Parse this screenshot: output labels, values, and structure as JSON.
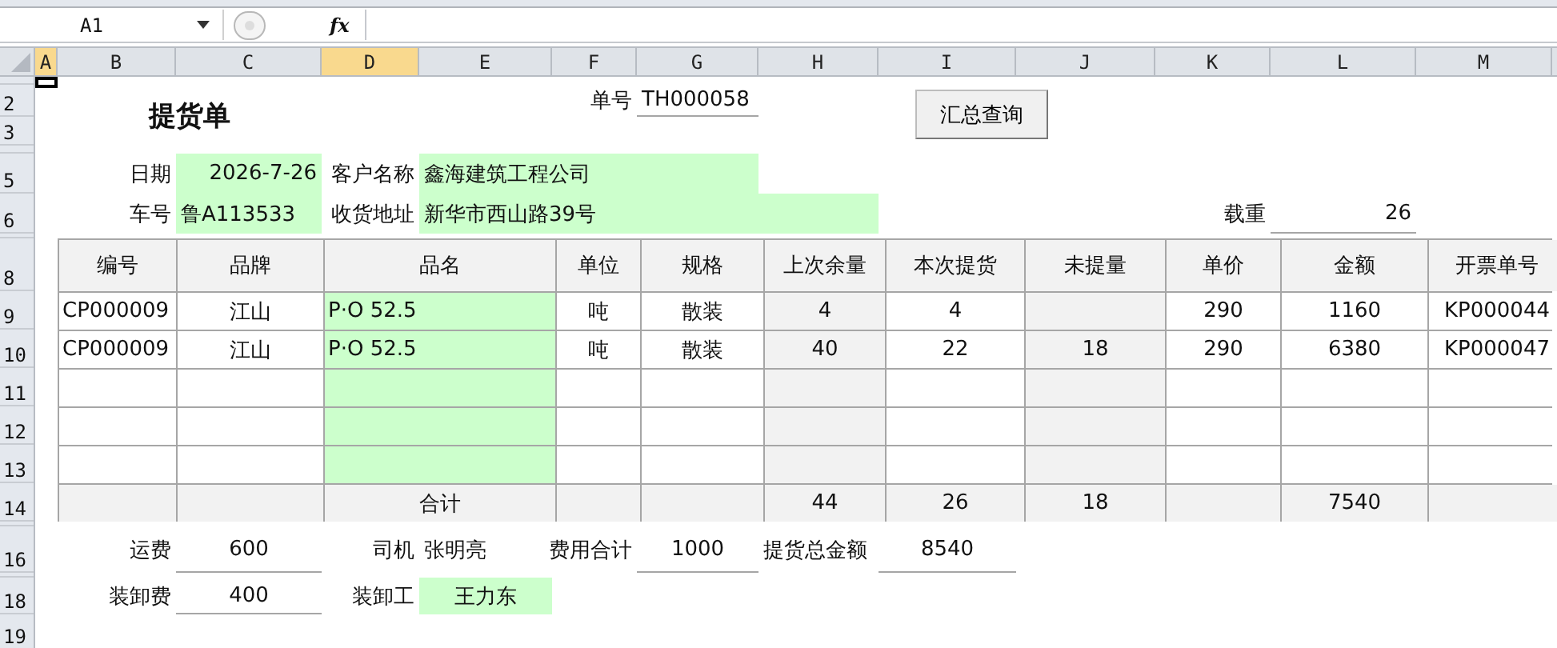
{
  "name_box": "A1",
  "function_label": "fx",
  "column_headers": [
    {
      "label": "A",
      "selected": true
    },
    {
      "label": "B",
      "selected": false
    },
    {
      "label": "C",
      "selected": false
    },
    {
      "label": "D",
      "selected": true
    },
    {
      "label": "E",
      "selected": false
    },
    {
      "label": "F",
      "selected": false
    },
    {
      "label": "G",
      "selected": false
    },
    {
      "label": "H",
      "selected": false
    },
    {
      "label": "I",
      "selected": false
    },
    {
      "label": "J",
      "selected": false
    },
    {
      "label": "K",
      "selected": false
    },
    {
      "label": "L",
      "selected": false
    },
    {
      "label": "M",
      "selected": false
    }
  ],
  "row_headers": [
    "2",
    "3",
    "5",
    "6",
    "8",
    "9",
    "10",
    "11",
    "12",
    "13",
    "14",
    "16",
    "18",
    "19"
  ],
  "form": {
    "title": "提货单",
    "order_no_label": "单号",
    "order_no": "TH000058",
    "summary_button": "汇总查询",
    "date_label": "日期",
    "date": "2026-7-26",
    "customer_label": "客户名称",
    "customer": "鑫海建筑工程公司",
    "plate_label": "车号",
    "plate": "鲁A113533",
    "address_label": "收货地址",
    "address": "新华市西山路39号",
    "load_label": "载重",
    "load": "26"
  },
  "table": {
    "columns": [
      "编号",
      "品牌",
      "品名",
      "单位",
      "规格",
      "上次余量",
      "本次提货",
      "未提量",
      "单价",
      "金额",
      "开票单号"
    ],
    "rows": [
      {
        "kind": "item",
        "cells": [
          "CP000009",
          "江山",
          "P·O 52.5",
          "吨",
          "散装",
          "4",
          "4",
          null,
          "290",
          "1160",
          "KP000044"
        ]
      },
      {
        "kind": "item",
        "cells": [
          "CP000009",
          "江山",
          "P·O 52.5",
          "吨",
          "散装",
          "40",
          "22",
          "18",
          "290",
          "6380",
          "KP000047"
        ]
      },
      {
        "kind": "item",
        "cells": [
          null,
          null,
          null,
          null,
          null,
          null,
          null,
          null,
          null,
          null,
          null
        ]
      },
      {
        "kind": "item",
        "cells": [
          null,
          null,
          null,
          null,
          null,
          null,
          null,
          null,
          null,
          null,
          null
        ]
      },
      {
        "kind": "item",
        "cells": [
          null,
          null,
          null,
          null,
          null,
          null,
          null,
          null,
          null,
          null,
          null
        ]
      },
      {
        "kind": "total",
        "cells": [
          null,
          null,
          "合计",
          null,
          null,
          "44",
          "26",
          "18",
          null,
          "7540",
          null
        ]
      }
    ]
  },
  "footer": {
    "freight_label": "运费",
    "freight": "600",
    "driver_label": "司机",
    "driver": "张明亮",
    "fee_total_label": "费用合计",
    "fee_total": "1000",
    "grand_total_label": "提货总金额",
    "grand_total": "8540",
    "loading_fee_label": "装卸费",
    "loading_fee": "400",
    "loader_label": "装卸工",
    "loader": "王力东"
  }
}
